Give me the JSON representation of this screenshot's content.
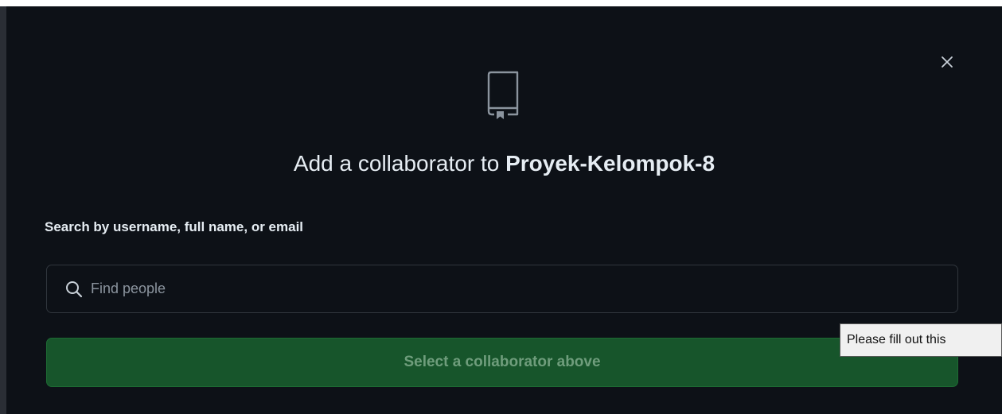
{
  "dialog": {
    "close_icon": "close-icon",
    "repo_icon": "repo-icon",
    "title_prefix": "Add a collaborator to ",
    "repo_name": "Proyek-Kelompok-8",
    "search_label": "Search by username, full name, or email",
    "search": {
      "icon": "search-icon",
      "placeholder": "Find people",
      "value": ""
    },
    "submit_label": "Select a collaborator above",
    "tooltip": "Please fill out this"
  },
  "colors": {
    "background": "#0d1117",
    "text": "#e6edf3",
    "muted": "#8b949e",
    "border": "#30363d",
    "button_bg": "#17552b",
    "button_text": "#6f9d7c"
  }
}
